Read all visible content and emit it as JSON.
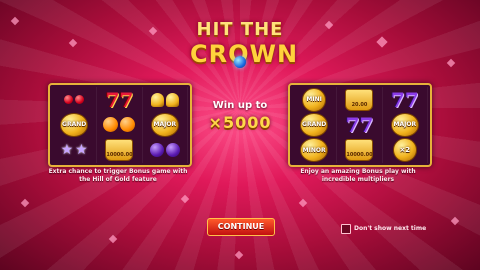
{
  "logo": {
    "line1": "HIT THE",
    "line2": "CROWN",
    "icon": "blue-gem-icon"
  },
  "win": {
    "label": "Win up to",
    "amount": "×5000"
  },
  "left_panel": {
    "description": "Extra chance to trigger Bonus game with the Hill of Gold feature",
    "grand_label": "GRAND",
    "major_label": "MAJOR",
    "crown_value": "10000.00"
  },
  "right_panel": {
    "description": "Enjoy an amazing Bonus play with incredible multipliers",
    "mini_label": "MINI",
    "top_crown_value": "20.00",
    "grand_label": "GRAND",
    "major_label": "MAJOR",
    "minor_label": "MINOR",
    "crown_value": "10000.00",
    "multiplier_label": "×2"
  },
  "continue_button": {
    "label": "CONTINUE"
  },
  "dont_show": {
    "label": "Don't show next time",
    "checked": false
  },
  "colors": {
    "background": "#e0195a",
    "panel_border": "#e6b23a",
    "button": "#c21010",
    "gold_text": "#ffd84a"
  }
}
